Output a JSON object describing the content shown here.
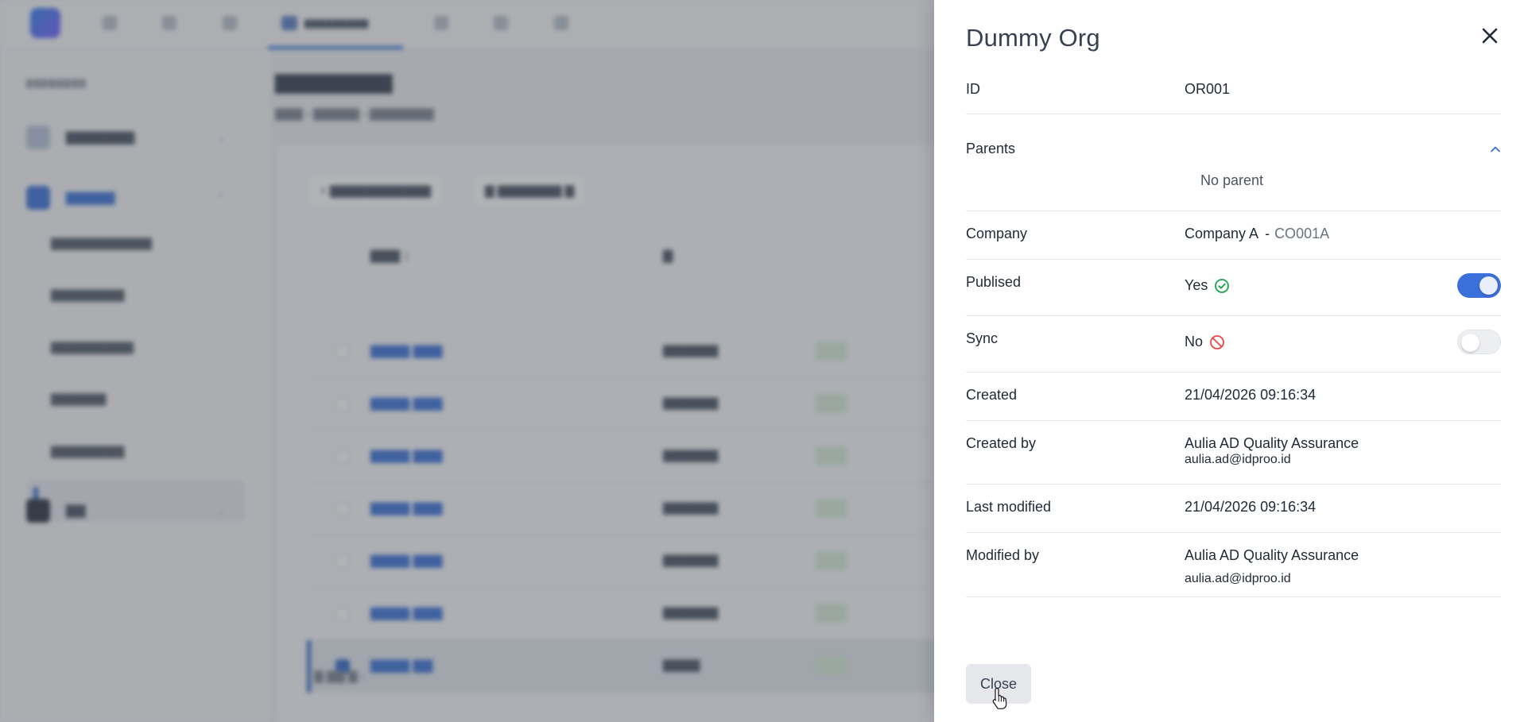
{
  "drawer": {
    "title": "Dummy Org",
    "id": {
      "label": "ID",
      "value": "OR001"
    },
    "parents": {
      "label": "Parents",
      "empty_text": "No parent"
    },
    "company": {
      "label": "Company",
      "name": "Company A",
      "separator": "-",
      "code": "CO001A"
    },
    "published": {
      "label": "Publised",
      "value": "Yes",
      "toggle_on": true
    },
    "sync": {
      "label": "Sync",
      "value": "No",
      "toggle_on": false
    },
    "created": {
      "label": "Created",
      "value": "21/04/2026 09:16:34"
    },
    "created_by": {
      "label": "Created by",
      "name": "Aulia AD Quality Assurance",
      "email": "aulia.ad@idproo.id"
    },
    "last_modified": {
      "label": "Last modified",
      "value": "21/04/2026 09:16:34"
    },
    "modified_by": {
      "label": "Modified by",
      "name": "Aulia AD Quality Assurance",
      "email": "aulia.ad@idproo.id"
    },
    "close_label": "Close"
  },
  "icons": {
    "close": "close-icon",
    "parents_toggle": "chevron-up-icon",
    "published_status": "check-circle-icon",
    "sync_status": "forbidden-icon"
  },
  "colors": {
    "accent": "#3b6fd9",
    "success": "#16a34a",
    "danger": "#ef4444",
    "overlay": "#464a50"
  }
}
